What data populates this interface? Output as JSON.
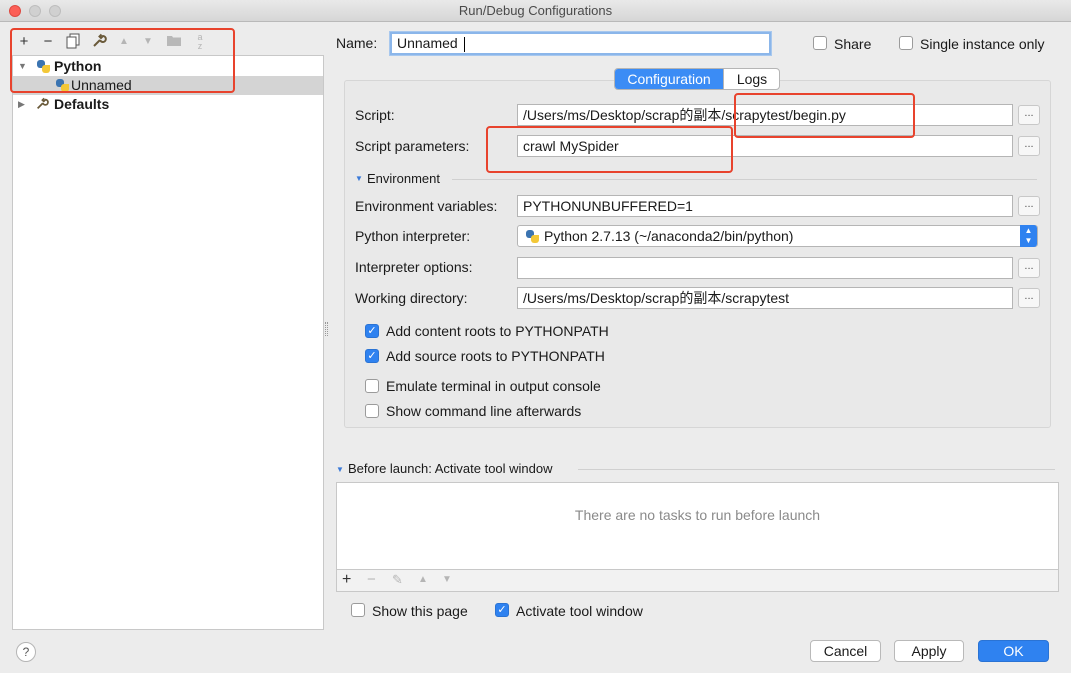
{
  "window": {
    "title": "Run/Debug Configurations"
  },
  "left": {
    "toolbar": {
      "add": "+",
      "remove": "−",
      "copy": "copy-icon",
      "edit_defaults": "wrench-icon",
      "move_up": "▲",
      "move_down": "▼",
      "folder": "folder-icon",
      "sort": "sort-icon"
    },
    "tree": {
      "python_label": "Python",
      "unnamed_label": "Unnamed",
      "defaults_label": "Defaults"
    }
  },
  "header": {
    "name_label": "Name:",
    "name_value": "Unnamed",
    "share_label": "Share",
    "share_checked": false,
    "single_instance_label": "Single instance only",
    "single_instance_checked": false
  },
  "tabs": {
    "configuration": "Configuration",
    "logs": "Logs",
    "active": "Configuration"
  },
  "form": {
    "script_label": "Script:",
    "script_value": "/Users/ms/Desktop/scrap的副本/scrapytest/begin.py",
    "script_params_label": "Script parameters:",
    "script_params_value": "crawl MySpider",
    "environment_section": "Environment",
    "env_vars_label": "Environment variables:",
    "env_vars_value": "PYTHONUNBUFFERED=1",
    "interpreter_label": "Python interpreter:",
    "interpreter_value": "Python 2.7.13 (~/anaconda2/bin/python)",
    "interp_options_label": "Interpreter options:",
    "interp_options_value": "",
    "working_dir_label": "Working directory:",
    "working_dir_value": "/Users/ms/Desktop/scrap的副本/scrapytest",
    "browse": "...",
    "checkboxes": [
      {
        "label": "Add content roots to PYTHONPATH",
        "checked": true
      },
      {
        "label": "Add source roots to PYTHONPATH",
        "checked": true
      },
      {
        "label": "Emulate terminal in output console",
        "checked": false
      },
      {
        "label": "Show command line afterwards",
        "checked": false
      }
    ]
  },
  "before_launch": {
    "title": "Before launch: Activate tool window",
    "empty_text": "There are no tasks to run before launch",
    "toolbar": {
      "add": "+",
      "remove": "−",
      "edit": "✎",
      "up": "▲",
      "down": "▼"
    }
  },
  "footer": {
    "show_page_label": "Show this page",
    "show_page_checked": false,
    "activate_label": "Activate tool window",
    "activate_checked": true,
    "help": "?",
    "cancel": "Cancel",
    "apply": "Apply",
    "ok": "OK"
  },
  "colors": {
    "accent": "#2f82f0",
    "highlight_box": "#e8432d",
    "selection": "#d4d4d4"
  }
}
